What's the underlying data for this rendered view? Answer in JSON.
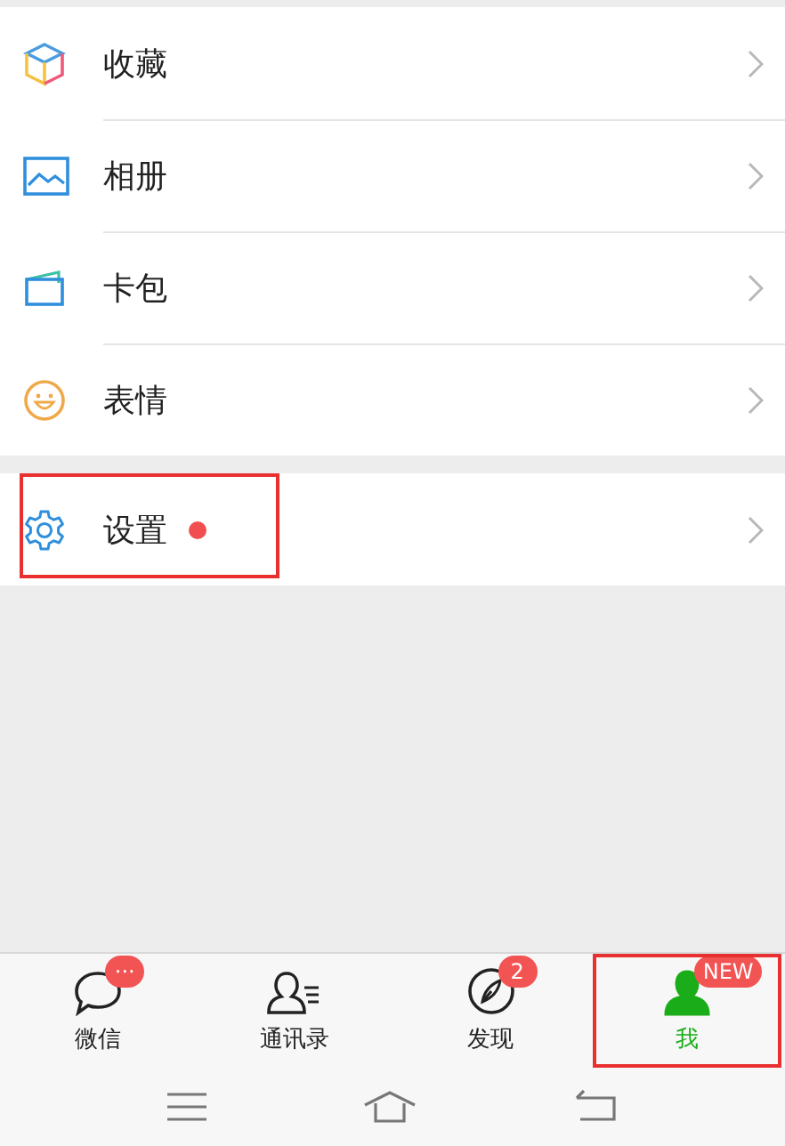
{
  "menu_groups": [
    {
      "items": [
        {
          "label": "收藏",
          "kind": "cube",
          "dot": false,
          "highlighted": false
        },
        {
          "label": "相册",
          "kind": "photo",
          "dot": false,
          "highlighted": false
        },
        {
          "label": "卡包",
          "kind": "card",
          "dot": false,
          "highlighted": false
        },
        {
          "label": "表情",
          "kind": "smile",
          "dot": false,
          "highlighted": false
        }
      ]
    },
    {
      "items": [
        {
          "label": "设置",
          "kind": "gear",
          "dot": true,
          "highlighted": true
        }
      ]
    }
  ],
  "tab_bar": [
    {
      "label": "微信",
      "kind": "chat",
      "badge": "···",
      "selected": false,
      "highlighted": false
    },
    {
      "label": "通讯录",
      "kind": "contacts",
      "selected": false,
      "highlighted": false
    },
    {
      "label": "发现",
      "kind": "compass",
      "badge": "2",
      "selected": false,
      "highlighted": false
    },
    {
      "label": "我",
      "kind": "person",
      "badge": "NEW",
      "selected": true,
      "highlighted": true
    }
  ]
}
